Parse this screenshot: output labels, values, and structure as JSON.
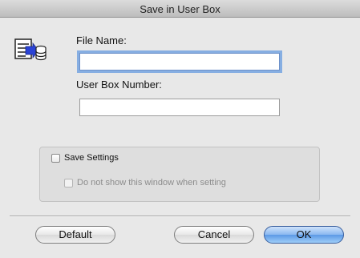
{
  "window": {
    "title": "Save in User Box"
  },
  "icon": {
    "name": "save-to-user-box-icon"
  },
  "form": {
    "file_name_label": "File Name:",
    "file_name_value": "",
    "user_box_number_label": "User Box Number:",
    "user_box_number_value": ""
  },
  "settings": {
    "save_settings_label": "Save Settings",
    "save_settings_checked": false,
    "do_not_show_label": "Do not show this window when setting",
    "do_not_show_checked": false,
    "do_not_show_enabled": false
  },
  "buttons": {
    "default_label": "Default",
    "cancel_label": "Cancel",
    "ok_label": "OK"
  },
  "colors": {
    "accent": "#5c99e6",
    "focus_ring": "#86aee2"
  }
}
